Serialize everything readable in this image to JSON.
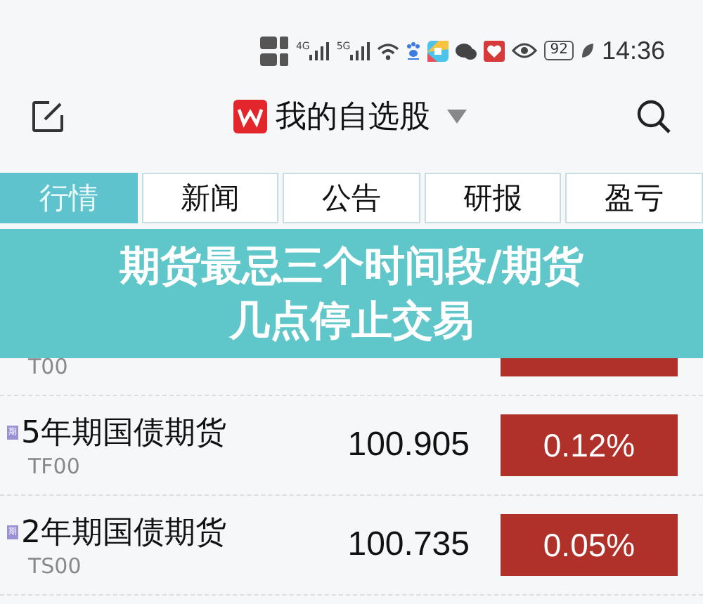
{
  "status_bar": {
    "signal_labels": [
      "4G",
      "5G"
    ],
    "battery": "92",
    "time": "14:36"
  },
  "toolbar": {
    "title": "我的自选股"
  },
  "tabs": [
    {
      "label": "行情",
      "selected": true
    },
    {
      "label": "新闻",
      "selected": false
    },
    {
      "label": "公告",
      "selected": false
    },
    {
      "label": "研报",
      "selected": false
    },
    {
      "label": "盈亏",
      "selected": false
    }
  ],
  "table": {
    "rows": [
      {
        "code": "T00"
      },
      {
        "badge": "期",
        "name": "5年期国债期货",
        "code": "TF00",
        "price": "100.905",
        "change": "0.12%"
      },
      {
        "badge": "期",
        "name": "2年期国债期货",
        "code": "TS00",
        "price": "100.735",
        "change": "0.05%"
      }
    ]
  },
  "banner": {
    "lines": [
      "期货最忌三个时间段/期货",
      "几点停止交易"
    ]
  }
}
